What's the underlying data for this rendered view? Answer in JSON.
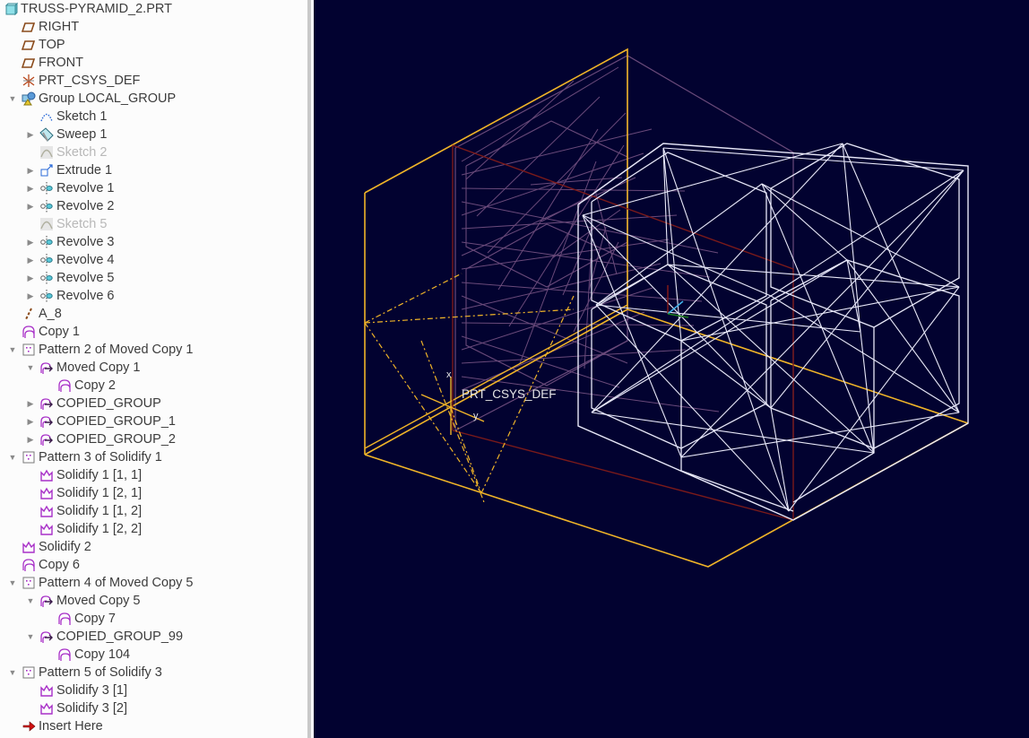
{
  "model_tree": {
    "root": {
      "label": "TRUSS-PYRAMID_2.PRT",
      "icon": "part-icon"
    },
    "items": [
      {
        "label": "RIGHT",
        "icon": "datum-plane-icon",
        "level": 1,
        "expander": "none"
      },
      {
        "label": "TOP",
        "icon": "datum-plane-icon",
        "level": 1,
        "expander": "none"
      },
      {
        "label": "FRONT",
        "icon": "datum-plane-icon",
        "level": 1,
        "expander": "none"
      },
      {
        "label": "PRT_CSYS_DEF",
        "icon": "csys-icon",
        "level": 1,
        "expander": "none"
      },
      {
        "label": "Group LOCAL_GROUP",
        "icon": "group-icon",
        "level": 1,
        "expander": "expanded"
      },
      {
        "label": "Sketch 1",
        "icon": "sketch-icon",
        "level": 2,
        "expander": "none"
      },
      {
        "label": "Sweep 1",
        "icon": "sweep-icon",
        "level": 2,
        "expander": "collapsed"
      },
      {
        "label": "Sketch 2",
        "icon": "sketch-suppressed-icon",
        "level": 2,
        "expander": "none",
        "dimmed": true
      },
      {
        "label": "Extrude 1",
        "icon": "extrude-icon",
        "level": 2,
        "expander": "collapsed"
      },
      {
        "label": "Revolve 1",
        "icon": "revolve-icon",
        "level": 2,
        "expander": "collapsed"
      },
      {
        "label": "Revolve 2",
        "icon": "revolve-icon",
        "level": 2,
        "expander": "collapsed"
      },
      {
        "label": "Sketch 5",
        "icon": "sketch-suppressed-icon",
        "level": 2,
        "expander": "none",
        "dimmed": true
      },
      {
        "label": "Revolve 3",
        "icon": "revolve-icon",
        "level": 2,
        "expander": "collapsed"
      },
      {
        "label": "Revolve 4",
        "icon": "revolve-icon",
        "level": 2,
        "expander": "collapsed"
      },
      {
        "label": "Revolve 5",
        "icon": "revolve-icon",
        "level": 2,
        "expander": "collapsed"
      },
      {
        "label": "Revolve 6",
        "icon": "revolve-icon",
        "level": 2,
        "expander": "collapsed"
      },
      {
        "label": "A_8",
        "icon": "datum-axis-icon",
        "level": 1,
        "expander": "none"
      },
      {
        "label": "Copy 1",
        "icon": "copy-icon",
        "level": 1,
        "expander": "none"
      },
      {
        "label": "Pattern 2 of Moved Copy 1",
        "icon": "pattern-icon",
        "level": 1,
        "expander": "expanded"
      },
      {
        "label": "Moved Copy 1",
        "icon": "moved-copy-icon",
        "level": 2,
        "expander": "expanded"
      },
      {
        "label": "Copy 2",
        "icon": "copy-icon",
        "level": 3,
        "expander": "none"
      },
      {
        "label": "COPIED_GROUP",
        "icon": "moved-copy-icon",
        "level": 2,
        "expander": "collapsed"
      },
      {
        "label": "COPIED_GROUP_1",
        "icon": "moved-copy-icon",
        "level": 2,
        "expander": "collapsed"
      },
      {
        "label": "COPIED_GROUP_2",
        "icon": "moved-copy-icon",
        "level": 2,
        "expander": "collapsed"
      },
      {
        "label": "Pattern 3 of Solidify 1",
        "icon": "pattern-icon",
        "level": 1,
        "expander": "expanded"
      },
      {
        "label": "Solidify 1 [1, 1]",
        "icon": "solidify-icon",
        "level": 2,
        "expander": "none"
      },
      {
        "label": "Solidify 1 [2, 1]",
        "icon": "solidify-icon",
        "level": 2,
        "expander": "none"
      },
      {
        "label": "Solidify 1 [1, 2]",
        "icon": "solidify-icon",
        "level": 2,
        "expander": "none"
      },
      {
        "label": "Solidify 1 [2, 2]",
        "icon": "solidify-icon",
        "level": 2,
        "expander": "none"
      },
      {
        "label": "Solidify 2",
        "icon": "solidify-icon",
        "level": 1,
        "expander": "none"
      },
      {
        "label": "Copy 6",
        "icon": "copy-icon",
        "level": 1,
        "expander": "none"
      },
      {
        "label": "Pattern 4 of Moved Copy 5",
        "icon": "pattern-icon",
        "level": 1,
        "expander": "expanded"
      },
      {
        "label": "Moved Copy 5",
        "icon": "moved-copy-icon",
        "level": 2,
        "expander": "expanded"
      },
      {
        "label": "Copy 7",
        "icon": "copy-icon",
        "level": 3,
        "expander": "none"
      },
      {
        "label": "COPIED_GROUP_99",
        "icon": "moved-copy-icon",
        "level": 2,
        "expander": "expanded"
      },
      {
        "label": "Copy 104",
        "icon": "copy-icon",
        "level": 3,
        "expander": "none"
      },
      {
        "label": "Pattern 5 of Solidify 3",
        "icon": "pattern-icon",
        "level": 1,
        "expander": "expanded"
      },
      {
        "label": "Solidify 3 [1]",
        "icon": "solidify-icon",
        "level": 2,
        "expander": "none"
      },
      {
        "label": "Solidify 3 [2]",
        "icon": "solidify-icon",
        "level": 2,
        "expander": "none"
      },
      {
        "label": "Insert Here",
        "icon": "insert-here-icon",
        "level": 1,
        "expander": "none"
      }
    ]
  },
  "viewport": {
    "csys_label": "PRT_CSYS_DEF",
    "csys_axis_x": "x",
    "csys_axis_y": "y",
    "colors": {
      "background": "#020230",
      "datum_plane": "#f0b428",
      "datum_plane_back": "#7a1a1a",
      "geometry_front": "#e8e8f8",
      "geometry_back": "#6a4a7a"
    }
  }
}
